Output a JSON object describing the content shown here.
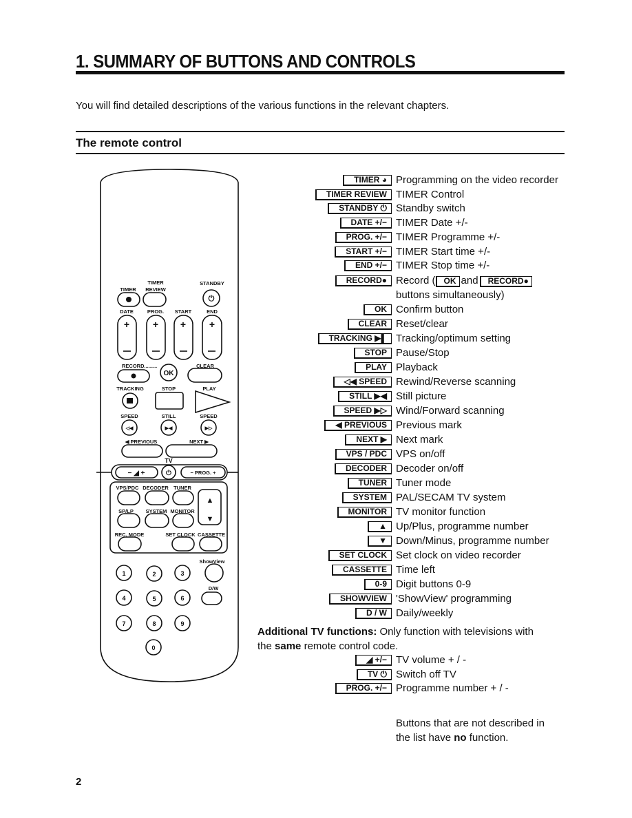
{
  "header": {
    "title": "1.   SUMMARY OF BUTTONS AND CONTROLS",
    "intro": "You will find detailed descriptions of the various functions in the relevant chapters.",
    "section": "The remote control"
  },
  "remote": {
    "labels": {
      "timer_review_top": "TIMER",
      "standby": "STANDBY",
      "timer": "TIMER",
      "review": "REVIEW",
      "date": "DATE",
      "prog": "PROG.",
      "start": "START",
      "end": "END",
      "record": "RECORD.........",
      "clear": "CLEAR",
      "ok": "OK",
      "tracking": "TRACKING",
      "stop": "STOP",
      "play": "PLAY",
      "speed_l": "SPEED",
      "still": "STILL",
      "speed_r": "SPEED",
      "previous": "◀ PREVIOUS",
      "next": "NEXT ▶",
      "tv": "TV",
      "tv_prog": "− PROG. +",
      "vps": "VPS/PDC",
      "decoder": "DECODER",
      "tuner": "TUNER",
      "splp": "SP/LP",
      "system": "SYSTEM",
      "monitor": "MONITOR",
      "recmode": "REC. MODE",
      "setclock": "SET CLOCK",
      "cassette": "CASSETTE",
      "showview": "ShowView",
      "dw": "D/W"
    },
    "digits": [
      "1",
      "2",
      "3",
      "4",
      "5",
      "6",
      "7",
      "8",
      "9",
      "0"
    ]
  },
  "list": [
    {
      "key": "TIMER ◕",
      "desc": "Programming on the video recorder"
    },
    {
      "key": "TIMER  REVIEW",
      "desc": "TIMER Control"
    },
    {
      "key": "STANDBY ⏻",
      "desc": "Standby switch"
    },
    {
      "key": "DATE  +/−",
      "desc": "TIMER Date +/-"
    },
    {
      "key": "PROG.  +/−",
      "desc": "TIMER Programme +/-"
    },
    {
      "key": "START  +/−",
      "desc": "TIMER Start time +/-"
    },
    {
      "key": "END +/−",
      "desc": "TIMER Stop time +/-"
    },
    {
      "key": "RECORD●",
      "desc": "Record (",
      "k2": "OK",
      "mid": "and",
      "k3": "RECORD●"
    },
    {
      "key": "",
      "desc": "buttons simultaneously)"
    },
    {
      "key": "OK",
      "desc": "Confirm button"
    },
    {
      "key": "CLEAR",
      "desc": "Reset/clear"
    },
    {
      "key": "TRACKING ▶▌",
      "desc": "Tracking/optimum setting"
    },
    {
      "key": "STOP",
      "desc": "Pause/Stop"
    },
    {
      "key": "PLAY",
      "desc": "Playback"
    },
    {
      "key": "◁◀ SPEED",
      "desc": "Rewind/Reverse scanning"
    },
    {
      "key": "STILL ▶◀",
      "desc": "Still picture"
    },
    {
      "key": "SPEED ▶▷",
      "desc": "Wind/Forward scanning"
    },
    {
      "key": "◀ PREVIOUS",
      "desc": "Previous mark"
    },
    {
      "key": "NEXT ▶",
      "desc": "Next mark"
    },
    {
      "key": "VPS / PDC",
      "desc": "VPS on/off"
    },
    {
      "key": "DECODER",
      "desc": "Decoder on/off"
    },
    {
      "key": "TUNER",
      "desc": "Tuner mode"
    },
    {
      "key": "SYSTEM",
      "desc": "PAL/SECAM TV system"
    },
    {
      "key": "MONITOR",
      "desc": "TV monitor function"
    },
    {
      "key": "▲",
      "desc": "Up/Plus, programme number"
    },
    {
      "key": "▼",
      "desc": "Down/Minus, programme number"
    },
    {
      "key": "SET CLOCK",
      "desc": "Set clock on video recorder"
    },
    {
      "key": "CASSETTE",
      "desc": "Time left"
    },
    {
      "key": "0-9",
      "desc": "Digit buttons 0-9"
    },
    {
      "key": "SHOWVIEW",
      "desc": "'ShowView' programming"
    },
    {
      "key": "D / W",
      "desc": "Daily/weekly"
    }
  ],
  "tv": {
    "heading": "Additional TV functions:",
    "text1": " Only function with televisions with",
    "text2a": "the ",
    "same": "same",
    "text2b": " remote control code.",
    "list": [
      {
        "key": "◢ +/−",
        "desc": "TV volume + / -"
      },
      {
        "key": "TV ⏻",
        "desc": "Switch off TV"
      },
      {
        "key": "PROG.  +/−",
        "desc": "Programme number + / -"
      }
    ]
  },
  "note": {
    "line1": "Buttons that are not described in",
    "line2a": "the list have ",
    "no": "no",
    "line2b": " function."
  },
  "page_number": "2"
}
